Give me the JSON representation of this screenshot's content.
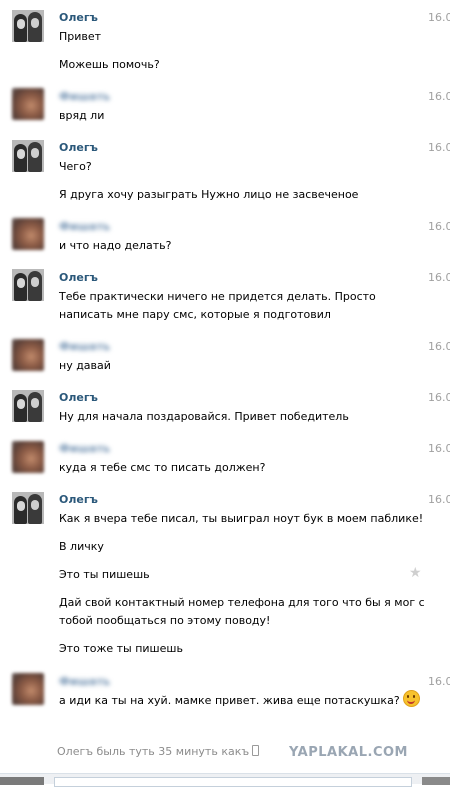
{
  "messages": [
    {
      "sender": "Олегъ",
      "time": "16.0",
      "avatar": "olegs",
      "lines": [
        "Привет",
        "Можешь помочь?"
      ]
    },
    {
      "sender": "Фишать",
      "time": "16.0",
      "avatar": "blur",
      "lines": [
        "вряд ли"
      ]
    },
    {
      "sender": "Олегъ",
      "time": "16.0",
      "avatar": "olegs",
      "lines": [
        "Чего?",
        "Я друга хочу разыграть Нужно лицо не засвеченое"
      ]
    },
    {
      "sender": "Фишать",
      "time": "16.0",
      "avatar": "blur",
      "lines": [
        "и что надо делать?"
      ]
    },
    {
      "sender": "Олегъ",
      "time": "16.0",
      "avatar": "olegs",
      "lines": [
        "Тебе практически ничего не придется делать. Просто",
        "написать мне пару смс, которые я подготовил"
      ]
    },
    {
      "sender": "Фишать",
      "time": "16.0",
      "avatar": "blur",
      "lines": [
        "ну давай"
      ]
    },
    {
      "sender": "Олегъ",
      "time": "16.0",
      "avatar": "olegs",
      "lines": [
        "Ну для начала поздаровайся. Привет победитель"
      ]
    },
    {
      "sender": "Фишать",
      "time": "16.0",
      "avatar": "blur",
      "lines": [
        "куда я тебе смс то писать должен?"
      ]
    },
    {
      "sender": "Олегъ",
      "time": "16.0",
      "avatar": "olegs",
      "lines": [
        "Как я вчера тебе писал, ты выиграл ноут бук в моем паблике!",
        "В личку",
        "Это ты пишешь",
        "Дай свой контактный номер телефона для того что бы я мог с",
        "тобой пообщаться по этому поводу!",
        "Это тоже ты пишешь"
      ]
    },
    {
      "sender": "Фишать",
      "time": "16.0",
      "avatar": "blur",
      "lines": [
        "а иди ка ты на хуй. мамке привет. жива еще потаскушка?"
      ],
      "emoji": "smile-emoji"
    }
  ],
  "status_text": "Олегъ быль туть 35 минуть какъ",
  "watermark": "YAPLAKAL.COM",
  "colors": {
    "name": "#2b587a",
    "time": "#a0a0a0",
    "status": "#8c8c8c"
  },
  "icons": {
    "star": "star-icon",
    "phone": "phone-icon"
  }
}
